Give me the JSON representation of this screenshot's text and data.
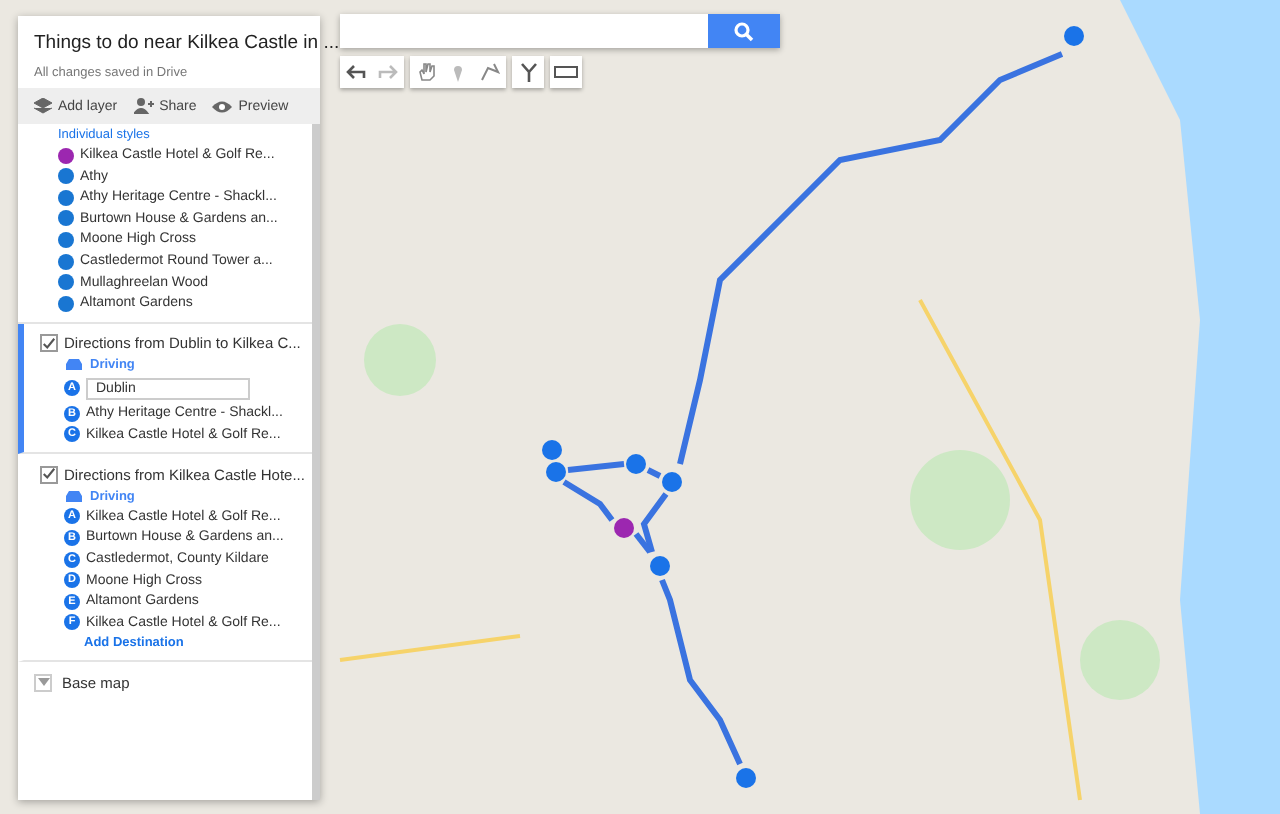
{
  "panel": {
    "title": "Things to do near Kilkea Castle in ...",
    "subtitle": "All changes saved in Drive",
    "actions": [
      "Add layer",
      "Share",
      "Preview"
    ]
  },
  "layers": [
    {
      "kind": "places",
      "style_link": "Individual styles",
      "items": [
        {
          "label": "Kilkea Castle Hotel & Golf Re...",
          "color": "#9c27b0"
        },
        {
          "label": "Athy",
          "color": "#1976d2"
        },
        {
          "label": "Athy Heritage Centre - Shackl...",
          "color": "#1976d2"
        },
        {
          "label": "Burtown House & Gardens an...",
          "color": "#1976d2"
        },
        {
          "label": "Moone High Cross",
          "color": "#1976d2"
        },
        {
          "label": "Castledermot Round Tower a...",
          "color": "#1976d2"
        },
        {
          "label": "Mullaghreelan Wood",
          "color": "#1976d2"
        },
        {
          "label": "Altamont Gardens",
          "color": "#1976d2"
        }
      ]
    },
    {
      "kind": "directions",
      "title": "Directions from Dublin to Kilkea C...",
      "checked": true,
      "selected": true,
      "mode": "Driving",
      "stops": [
        {
          "letter": "A",
          "label": "Dublin",
          "editing": true
        },
        {
          "letter": "B",
          "label": "Athy Heritage Centre - Shackl...",
          "editing": false
        },
        {
          "letter": "C",
          "label": "Kilkea Castle Hotel & Golf Re...",
          "editing": false
        }
      ]
    },
    {
      "kind": "directions",
      "title": "Directions from Kilkea Castle Hote...",
      "checked": true,
      "selected": false,
      "mode": "Driving",
      "add_link": "Add Destination",
      "stops": [
        {
          "letter": "A",
          "label": "Kilkea Castle Hotel & Golf Re...",
          "editing": false
        },
        {
          "letter": "B",
          "label": "Burtown House & Gardens an...",
          "editing": false
        },
        {
          "letter": "C",
          "label": "Castledermot, County Kildare",
          "editing": false
        },
        {
          "letter": "D",
          "label": "Moone High Cross",
          "editing": false
        },
        {
          "letter": "E",
          "label": "Altamont Gardens",
          "editing": false
        },
        {
          "letter": "F",
          "label": "Kilkea Castle Hotel & Golf Re...",
          "editing": false
        }
      ]
    }
  ],
  "base_map": {
    "label": "Base map",
    "expanded": false
  }
}
